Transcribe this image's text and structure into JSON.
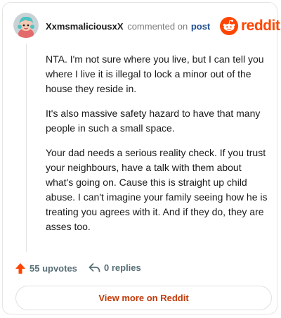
{
  "comment": {
    "username": "XxmsmaliciousxX",
    "meta": "commented on",
    "post_link": "post",
    "paragraphs": [
      "NTA. I'm not sure where you live, but I can tell you where I live it is illegal to lock a minor out of the house they reside in.",
      "It's also massive safety hazard to have that many people in such a small space.",
      "Your dad needs a serious reality check. If you trust your neighbours, have a talk with them about what's going on. Cause this is straight up child abuse. I can't imagine your family seeing how he is treating you agrees with it. And if they do, they are asses too."
    ]
  },
  "brand": {
    "name": "reddit",
    "color": "#ff4500"
  },
  "actions": {
    "upvotes_label": "55 upvotes",
    "replies_label": "0 replies"
  },
  "footer": {
    "view_more_label": "View more on Reddit"
  },
  "icons": {
    "avatar": "snoo-avatar-icon",
    "brand": "reddit-logo-icon",
    "upvote": "upvote-arrow-icon",
    "reply": "reply-arrow-icon"
  }
}
